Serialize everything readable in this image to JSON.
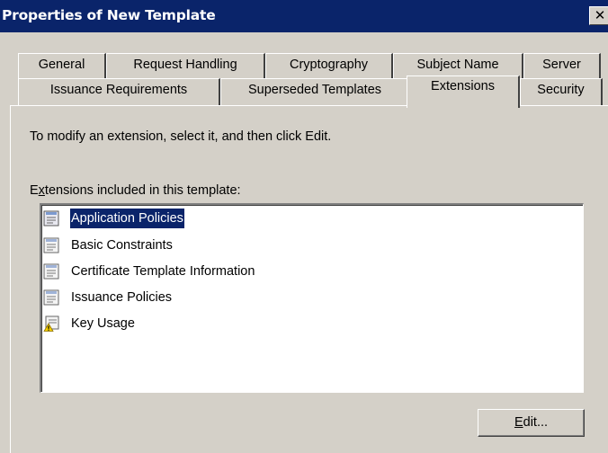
{
  "window": {
    "title": "Properties of New Template",
    "close_glyph": "✕"
  },
  "tabs_row1": [
    {
      "label": "General"
    },
    {
      "label": "Request Handling"
    },
    {
      "label": "Cryptography"
    },
    {
      "label": "Subject Name"
    },
    {
      "label": "Server"
    }
  ],
  "tabs_row2": [
    {
      "label": "Issuance Requirements"
    },
    {
      "label": "Superseded Templates"
    },
    {
      "label": "Extensions",
      "selected": true
    },
    {
      "label": "Security"
    }
  ],
  "extensions_tab": {
    "instruction": "To modify an extension, select it, and then click Edit.",
    "list_label_mnemonic": "x",
    "list_label_before": "E",
    "list_label_after": "tensions included in this template:",
    "items": [
      {
        "label": "Application Policies",
        "icon": "extension-icon",
        "selected": true
      },
      {
        "label": "Basic Constraints",
        "icon": "extension-icon"
      },
      {
        "label": "Certificate Template Information",
        "icon": "extension-icon"
      },
      {
        "label": "Issuance Policies",
        "icon": "extension-icon"
      },
      {
        "label": "Key Usage",
        "icon": "extension-warning-icon"
      }
    ],
    "edit_button": {
      "mnemonic": "E",
      "rest": "dit..."
    }
  },
  "colors": {
    "titlebar": "#0a246a",
    "face": "#d4d0c8",
    "selection": "#0a246a"
  }
}
